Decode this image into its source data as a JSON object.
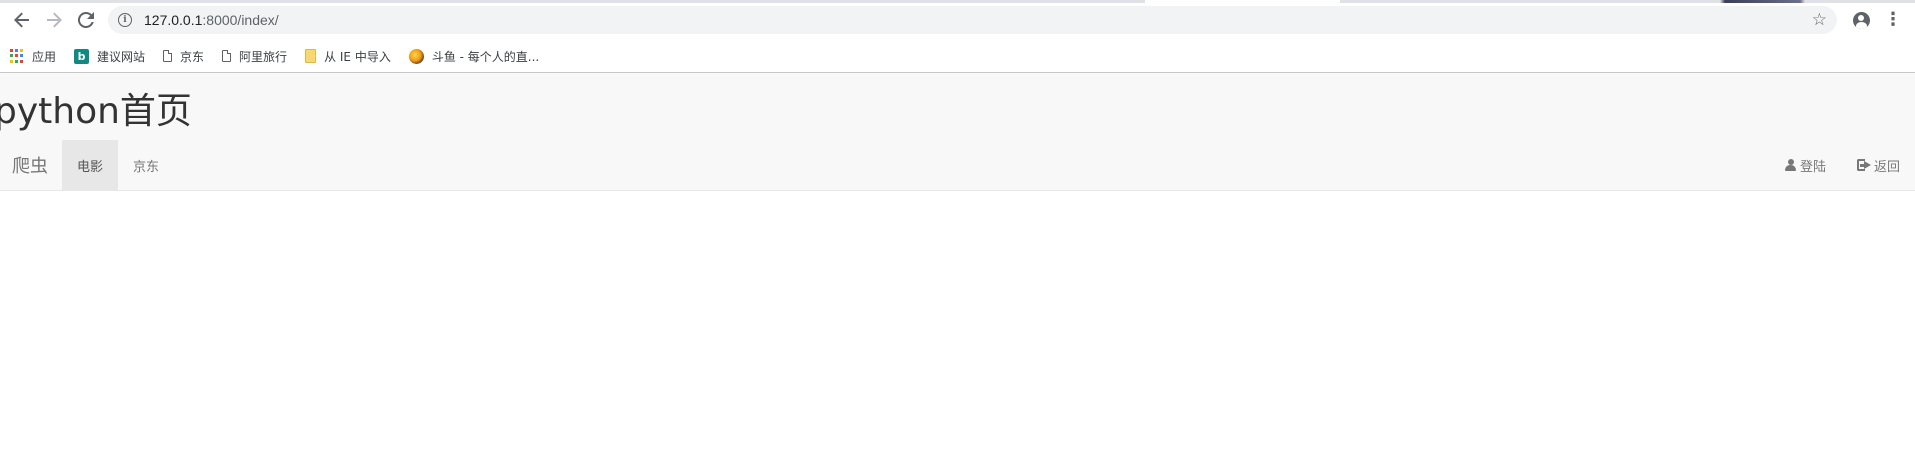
{
  "browser": {
    "url_host": "127.0.0.1",
    "url_path": ":8000/index/",
    "bookmarks": [
      {
        "label": "应用",
        "icon": "apps-icon"
      },
      {
        "label": "建议网站",
        "icon": "bing-icon"
      },
      {
        "label": "京东",
        "icon": "page-icon"
      },
      {
        "label": "阿里旅行",
        "icon": "page-icon"
      },
      {
        "label": "从 IE 中导入",
        "icon": "folder-icon"
      },
      {
        "label": "斗鱼 - 每个人的直...",
        "icon": "douyu-icon"
      }
    ]
  },
  "page": {
    "title": "python首页",
    "navbar": {
      "brand": "爬虫",
      "items": [
        {
          "label": "电影",
          "active": true
        },
        {
          "label": "京东",
          "active": false
        }
      ],
      "right": [
        {
          "label": "登陆",
          "icon": "user-icon"
        },
        {
          "label": "返回",
          "icon": "logout-icon"
        }
      ]
    }
  },
  "colors": {
    "navbar_bg": "#f8f8f8",
    "active_item_bg": "#e7e7e7",
    "nav_text": "#777777"
  }
}
